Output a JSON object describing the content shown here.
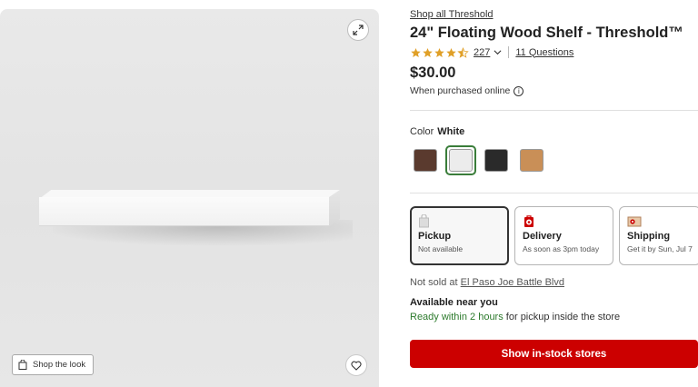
{
  "gallery": {
    "shop_look_label": "Shop the look",
    "expand_icon": "expand-icon",
    "favorite_icon": "heart-icon",
    "shop_look_icon": "shopping-bag-icon"
  },
  "product": {
    "brand_link": "Shop all Threshold",
    "title": "24\" Floating Wood Shelf - Threshold™",
    "rating": {
      "value": 4.5,
      "max": 5,
      "review_count": "227",
      "questions": "11 Questions",
      "star_color": "#e0a028"
    },
    "price": "$30.00",
    "purchased_note": "When purchased online",
    "color": {
      "label": "Color",
      "selected": "White",
      "swatches": [
        {
          "name": "Brown",
          "color": "#5a3a2e",
          "selected": false
        },
        {
          "name": "White",
          "color": "#ececec",
          "selected": true
        },
        {
          "name": "Black",
          "color": "#2a2a2a",
          "selected": false
        },
        {
          "name": "Natural",
          "color": "#c98f57",
          "selected": false
        }
      ]
    },
    "fulfillment": [
      {
        "title": "Pickup",
        "subtitle": "Not available",
        "icon": "store-pickup-icon"
      },
      {
        "title": "Delivery",
        "subtitle": "As soon as 3pm today",
        "icon": "delivery-icon"
      },
      {
        "title": "Shipping",
        "subtitle": "Get it by Sun, Jul 7",
        "icon": "shipping-box-icon"
      }
    ],
    "store": {
      "prefix": "Not sold at",
      "name": "El Paso Joe Battle Blvd"
    },
    "availability": {
      "title": "Available near you",
      "ready": "Ready within 2 hours",
      "suffix": "for pickup inside the store"
    },
    "cta_label": "Show in-stock stores",
    "accent_color": "#cc0000"
  }
}
